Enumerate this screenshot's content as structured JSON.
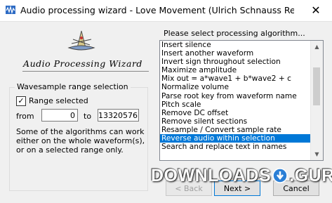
{
  "window": {
    "title": "Audio processing wizard - Love Movement (Ulrich Schnauss Remix) (zaycev...",
    "close_glyph": "✕"
  },
  "logo": {
    "text": "Audio Processing Wizard",
    "icon": "wizard-hat-icon"
  },
  "range_group": {
    "title": "Wavesample range selection",
    "checkbox_label": "Range selected",
    "checkbox_checked": true,
    "from_label": "from",
    "from_value": "0",
    "to_label": "to",
    "to_value": "13320576",
    "description": "Some of the algorithms can work either on the whole waveform(s), or on a selected range only."
  },
  "algorithm_list": {
    "label": "Please select processing algorithm...",
    "items": [
      "Insert silence",
      "Insert another waveform",
      "Invert sign throughout selection",
      "Maximize amplitude",
      "Mix out = a*wave1 + b*wave2 + c",
      "Normalize volume",
      "Parse root key from waveform name",
      "Pitch scale",
      "Remove DC offset",
      "Remove silent sections",
      "Resample / Convert sample rate",
      "Reverse audio within selection",
      "Search and replace text in names"
    ],
    "selected_index": 11
  },
  "buttons": {
    "back": "< Back",
    "next": "Next >",
    "cancel": "Cancel"
  },
  "watermark": {
    "left": "DOWNLOADS",
    "right": ".GURU"
  }
}
